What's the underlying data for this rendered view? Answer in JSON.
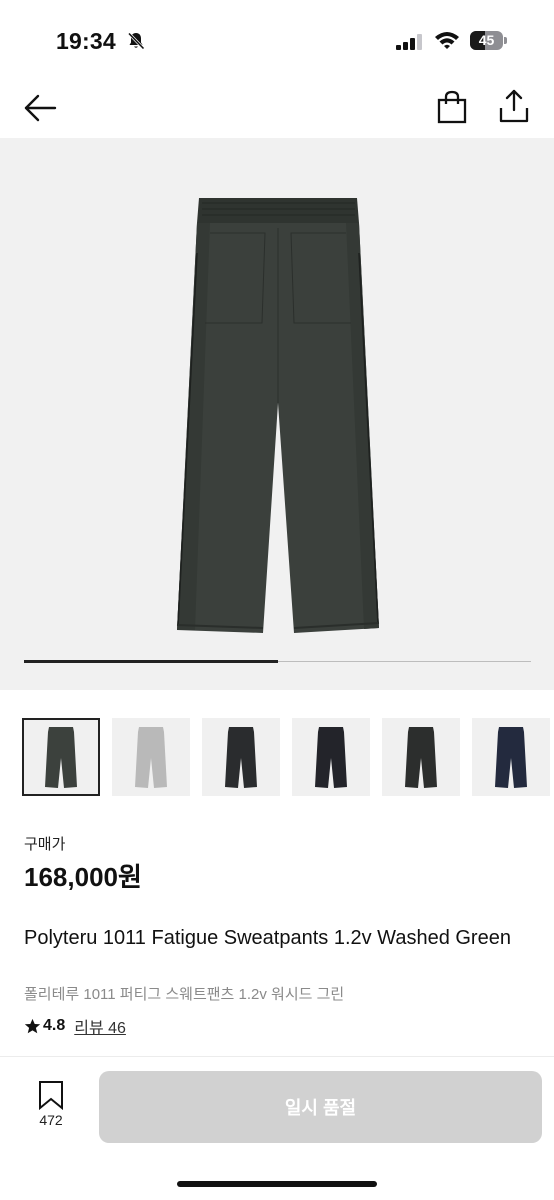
{
  "status": {
    "time": "19:34",
    "battery_percent": 45,
    "battery_label": "45"
  },
  "nav": {
    "back_icon": "arrow-left-icon",
    "bag_icon": "shopping-bag-icon",
    "share_icon": "share-icon"
  },
  "gallery": {
    "progress_fraction": 0.5,
    "thumbnails": [
      {
        "color": "#3c413d",
        "selected": true
      },
      {
        "color": "#b9b9b9",
        "selected": false
      },
      {
        "color": "#2a2c2e",
        "selected": false
      },
      {
        "color": "#23242a",
        "selected": false
      },
      {
        "color": "#2c2e2d",
        "selected": false
      },
      {
        "color": "#232a3e",
        "selected": false
      }
    ]
  },
  "product": {
    "price_label": "구매가",
    "price": "168,000원",
    "title_en": "Polyteru 1011 Fatigue Sweatpants 1.2v Washed Green",
    "title_ko": "폴리테루 1011 퍼티그 스웨트팬츠 1.2v 워시드 그린",
    "rating": "4.8",
    "review_text": "리뷰 46"
  },
  "bottom_bar": {
    "bookmark_count": "472",
    "soldout_label": "일시 품절"
  }
}
